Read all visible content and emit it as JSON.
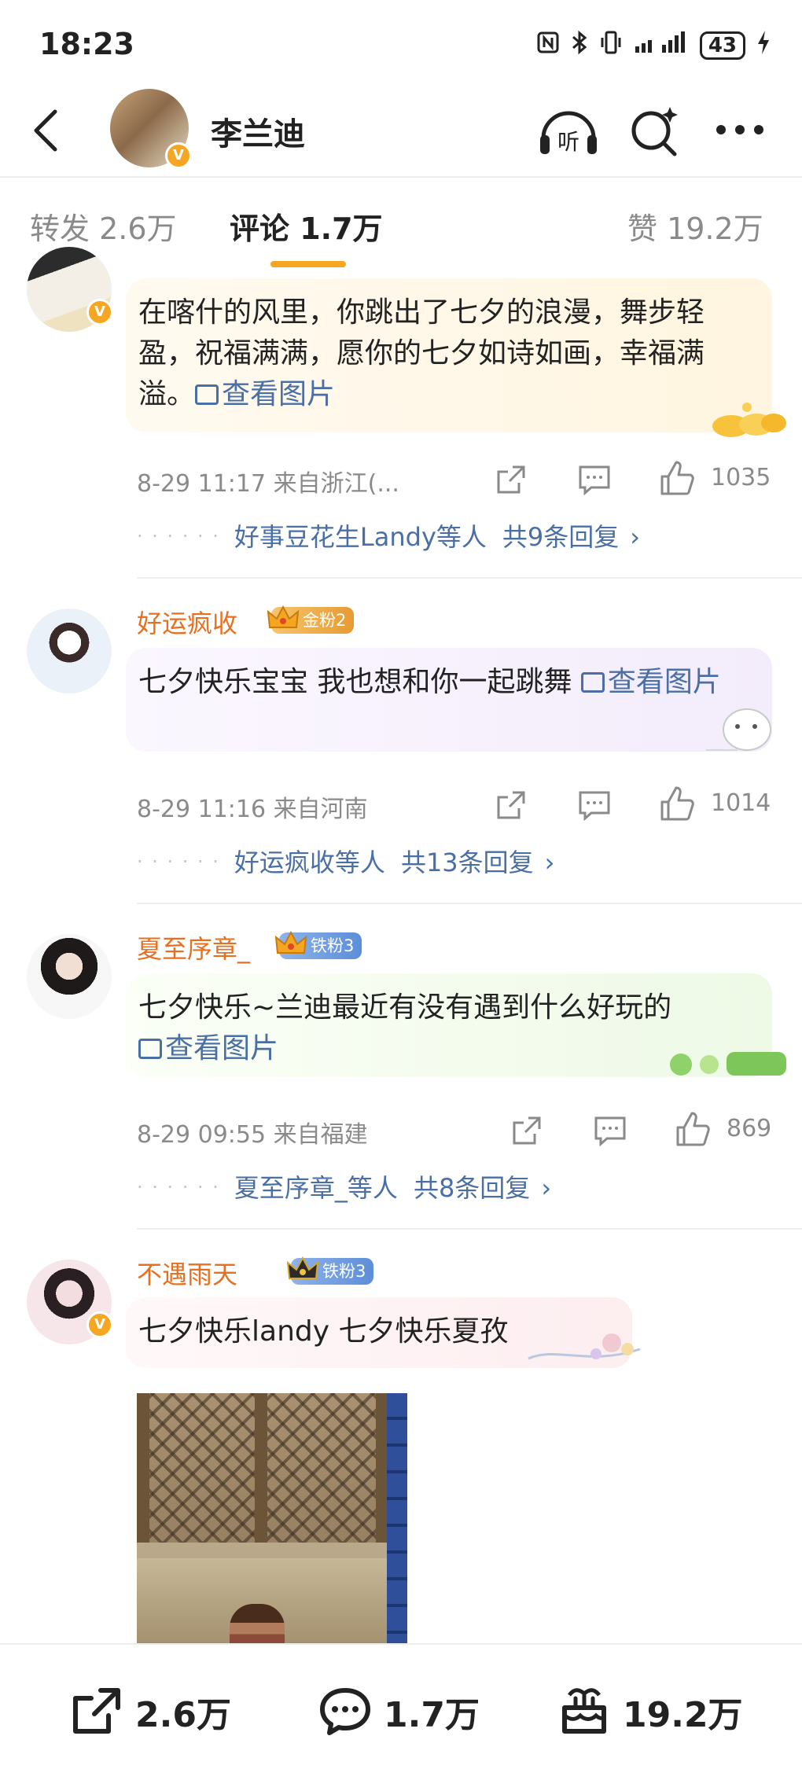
{
  "status_bar": {
    "time": "18:23",
    "battery": "43"
  },
  "header": {
    "name": "李兰迪",
    "listen_label": "听"
  },
  "tabs": [
    {
      "label": "转发 2.6万"
    },
    {
      "label": "评论 1.7万"
    },
    {
      "label": "赞 19.2万"
    }
  ],
  "comments": [
    {
      "username": "",
      "text": "在喀什的风里，你跳出了七夕的浪漫，舞步轻盈，祝福满满，愿你的七夕如诗如画，幸福满溢。",
      "view_image": "查看图片",
      "time_location": "8-29 11:17  来自浙江(...",
      "likes": "1035",
      "reply_names": "好事豆花生Landy等人",
      "reply_total": "共9条回复"
    },
    {
      "username": "好运疯收",
      "fan_badge": "金粉2",
      "text": "七夕快乐宝宝 我也想和你一起跳舞",
      "view_image": "查看图片",
      "time_location": "8-29 11:16  来自河南",
      "likes": "1014",
      "reply_names": "好运疯收等人",
      "reply_total": "共13条回复"
    },
    {
      "username": "夏至序章_",
      "fan_badge": "铁粉3",
      "text": "七夕快乐~兰迪最近有没有遇到什么好玩的",
      "view_image": "查看图片",
      "time_location": "8-29 09:55  来自福建",
      "likes": "869",
      "reply_names": "夏至序章_等人",
      "reply_total": "共8条回复"
    },
    {
      "username": "不遇雨天",
      "fan_badge": "铁粉3",
      "text": "七夕快乐landy 七夕快乐夏孜"
    }
  ],
  "bottom_bar": {
    "repost_count": "2.6万",
    "comment_count": "1.7万",
    "like_count": "19.2万"
  },
  "colors": {
    "accent": "#f5a623",
    "username": "#e77020",
    "link": "#4a6fa5"
  }
}
